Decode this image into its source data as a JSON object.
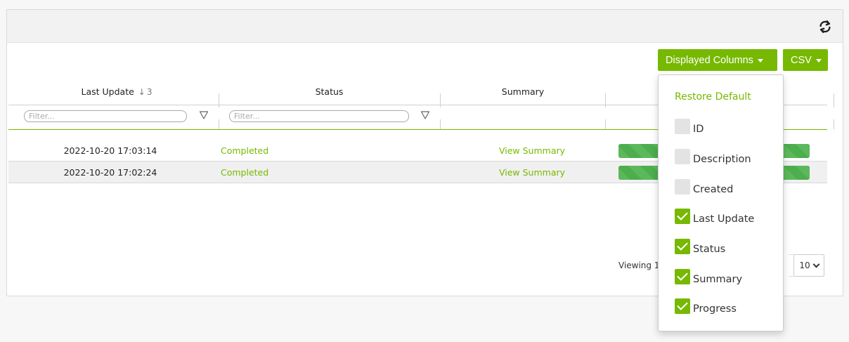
{
  "toolbar": {
    "refresh_icon": "refresh-icon"
  },
  "buttons": {
    "displayed_columns": "Displayed Columns",
    "csv": "CSV"
  },
  "table": {
    "columns": [
      {
        "label": "Last Update",
        "sort_arrow": "↓",
        "sort_index": "3"
      },
      {
        "label": "Status"
      },
      {
        "label": "Summary"
      }
    ],
    "filter_placeholder": "Filter...",
    "rows": [
      {
        "last_update": "2022-10-20 17:03:14",
        "status": "Completed",
        "summary": "View Summary",
        "progress": 1.0
      },
      {
        "last_update": "2022-10-20 17:02:24",
        "status": "Completed",
        "summary": "View Summary",
        "progress": 1.0
      }
    ]
  },
  "footer": {
    "viewing": "Viewing 1",
    "page_size": "10"
  },
  "column_menu": {
    "restore_default": "Restore Default",
    "items": [
      {
        "label": "ID",
        "checked": false
      },
      {
        "label": "Description",
        "checked": false
      },
      {
        "label": "Created",
        "checked": false
      },
      {
        "label": "Last Update",
        "checked": true
      },
      {
        "label": "Status",
        "checked": true
      },
      {
        "label": "Summary",
        "checked": true
      },
      {
        "label": "Progress",
        "checked": true
      }
    ]
  },
  "colors": {
    "accent": "#76b900",
    "progress": "#5cb85c"
  }
}
